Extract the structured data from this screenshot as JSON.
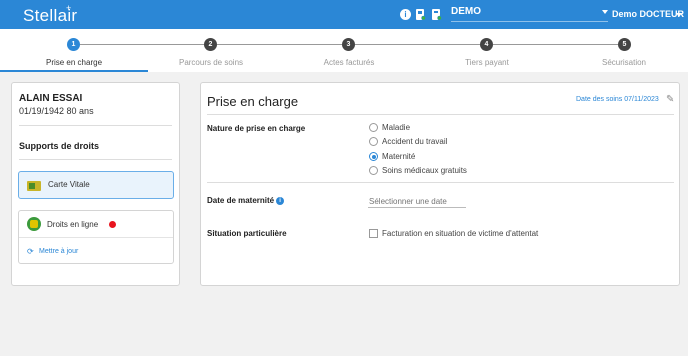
{
  "app": {
    "logo": "Stellair",
    "demo_select": "DEMO",
    "user_name": "Demo DOCTEUR"
  },
  "stepper": {
    "steps": [
      {
        "number": "1",
        "label": "Prise en charge",
        "active": true
      },
      {
        "number": "2",
        "label": "Parcours de soins",
        "active": false
      },
      {
        "number": "3",
        "label": "Actes facturés",
        "active": false
      },
      {
        "number": "4",
        "label": "Tiers payant",
        "active": false
      },
      {
        "number": "5",
        "label": "Sécurisation",
        "active": false
      }
    ]
  },
  "patient": {
    "name": "ALAIN ESSAI",
    "dob_age": "01/19/1942 80 ans"
  },
  "supports": {
    "title": "Supports de droits",
    "carte_vitale": "Carte Vitale",
    "droits_en_ligne": "Droits en ligne",
    "mettre_a_jour": "Mettre à jour"
  },
  "prise_en_charge": {
    "title": "Prise en charge",
    "date_soins": "Date des soins 07/11/2023",
    "nature_label": "Nature de prise en charge",
    "nature_options": [
      {
        "label": "Maladie",
        "checked": false
      },
      {
        "label": "Accident du travail",
        "checked": false
      },
      {
        "label": "Maternité",
        "checked": true
      },
      {
        "label": "Soins médicaux gratuits",
        "checked": false
      }
    ],
    "date_maternite_label": "Date de maternité",
    "date_placeholder": "Sélectionner une date",
    "situation_label": "Situation particulière",
    "situation_checkbox": "Facturation en situation de victime d'attentat",
    "situation_checked": false
  },
  "colors": {
    "primary": "#2b87d6",
    "background": "#f1f1f1",
    "alert": "#e8141e"
  }
}
